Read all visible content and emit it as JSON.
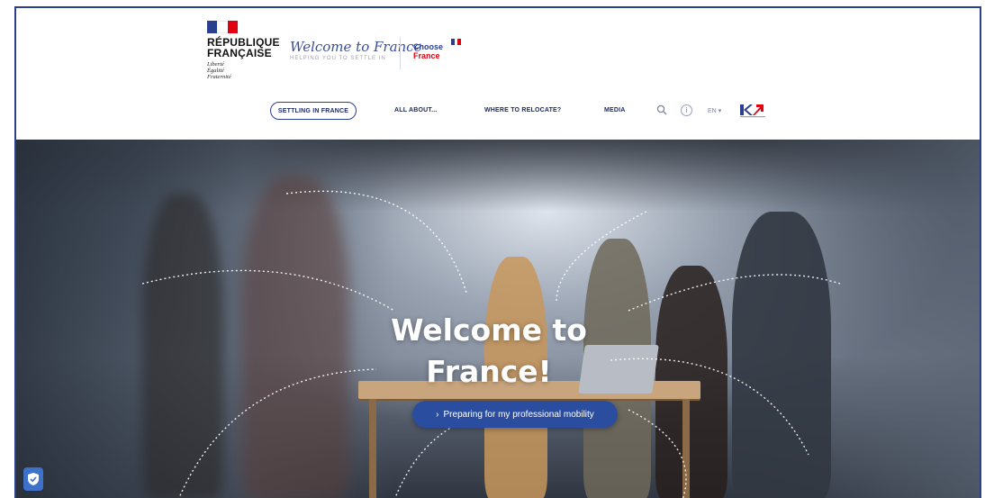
{
  "header": {
    "republic": {
      "title_line1": "RÉPUBLIQUE",
      "title_line2": "FRANÇAISE",
      "motto": [
        "Liberté",
        "Égalité",
        "Fraternité"
      ]
    },
    "welcome_script": "Welcome to France",
    "welcome_sub": "HELPING YOU TO SETTLE IN",
    "choose_line1": "Choose",
    "choose_line2": "France"
  },
  "nav": {
    "items": [
      {
        "label": "SETTLING IN FRANCE",
        "active": true
      },
      {
        "label": "ALL ABOUT...",
        "active": false
      },
      {
        "label": "WHERE TO RELOCATE?",
        "active": false
      },
      {
        "label": "MEDIA",
        "active": false
      }
    ],
    "search_icon": "search-icon",
    "info_icon": "info-icon",
    "language": "EN",
    "language_icon": "chevron-down-icon",
    "partner_logo": "business-france-logo"
  },
  "hero": {
    "title_line1": "Welcome to",
    "title_line2": "France!",
    "cta_label": "Preparing for my professional mobility"
  },
  "colors": {
    "brand_blue": "#2b3f8f",
    "brand_red": "#e1000f",
    "cta_blue": "#2b4da0",
    "shield_blue": "#3e71c9"
  }
}
